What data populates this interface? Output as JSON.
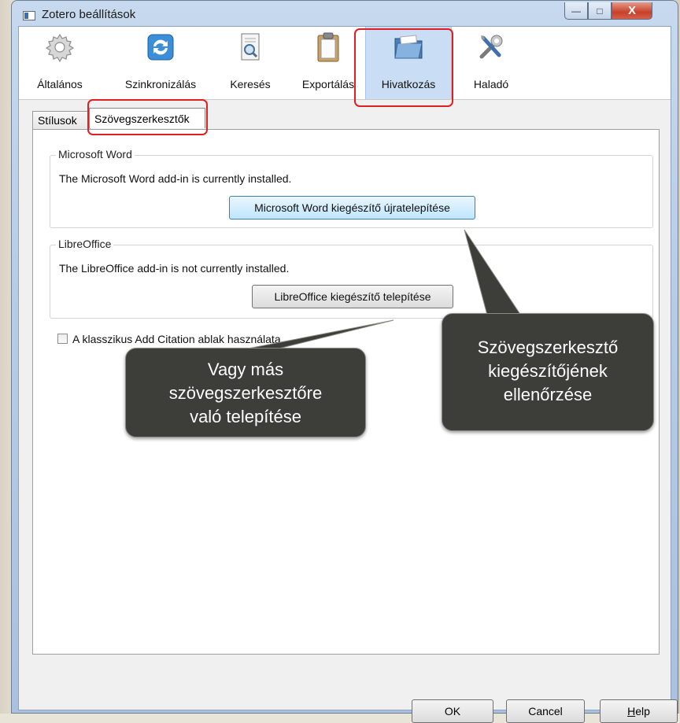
{
  "window": {
    "title": "Zotero beállítások",
    "close_glyph": "X",
    "minimize_glyph": "—",
    "maximize_glyph": "□"
  },
  "toolbar": {
    "items": [
      {
        "label": "Általános",
        "icon": "gear-icon"
      },
      {
        "label": "Szinkronizálás",
        "icon": "sync-icon"
      },
      {
        "label": "Keresés",
        "icon": "search-document-icon"
      },
      {
        "label": "Exportálás",
        "icon": "clipboard-icon"
      },
      {
        "label": "Hivatkozás",
        "icon": "folder-icon",
        "selected": true
      },
      {
        "label": "Haladó",
        "icon": "tools-icon"
      }
    ]
  },
  "tabs": [
    {
      "label": "Stílusok"
    },
    {
      "label": "Szövegszerkesztők",
      "selected": true
    }
  ],
  "word_group": {
    "legend": "Microsoft Word",
    "status": "The Microsoft Word add-in is currently installed.",
    "button": "Microsoft Word kiegészítő újratelepítése"
  },
  "libreoffice_group": {
    "legend": "LibreOffice",
    "status": "The LibreOffice add-in is not currently installed.",
    "button": "LibreOffice kiegészítő telepítése"
  },
  "classic_checkbox": {
    "label": "A klasszikus Add Citation ablak használata",
    "checked": false
  },
  "callouts": {
    "left": [
      "Vagy más",
      "szövegszerkesztőre",
      "való telepítése"
    ],
    "right": [
      "Szövegszerkesztő",
      "kiegészítőjének",
      "ellenőrzése"
    ]
  },
  "footer": {
    "ok": "OK",
    "cancel": "Cancel",
    "help_u": "H",
    "help_rest": "elp"
  },
  "colors": {
    "highlight": "#e02020",
    "selected_tab_bg": "#c9def5",
    "callout_bg": "#3d3d3a"
  }
}
